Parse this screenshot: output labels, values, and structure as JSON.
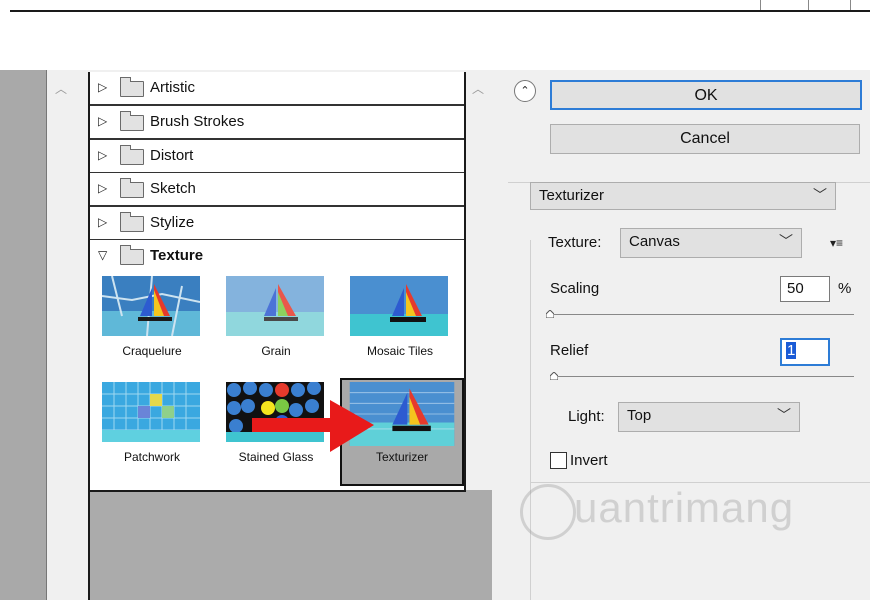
{
  "categories": [
    {
      "label": "Artistic"
    },
    {
      "label": "Brush Strokes"
    },
    {
      "label": "Distort"
    },
    {
      "label": "Sketch"
    },
    {
      "label": "Stylize"
    },
    {
      "label": "Texture"
    }
  ],
  "thumbnails": [
    {
      "label": "Craquelure"
    },
    {
      "label": "Grain"
    },
    {
      "label": "Mosaic Tiles"
    },
    {
      "label": "Patchwork"
    },
    {
      "label": "Stained Glass"
    },
    {
      "label": "Texturizer"
    }
  ],
  "buttons": {
    "ok": "OK",
    "cancel": "Cancel"
  },
  "filter_select": {
    "value": "Texturizer"
  },
  "texture": {
    "label": "Texture:",
    "value": "Canvas"
  },
  "scaling": {
    "label": "Scaling",
    "value": "50",
    "unit": "%"
  },
  "relief": {
    "label": "Relief",
    "value": "1"
  },
  "light": {
    "label": "Light:",
    "value": "Top"
  },
  "invert": {
    "label": "Invert"
  },
  "watermark": {
    "text": "uantrimang"
  }
}
